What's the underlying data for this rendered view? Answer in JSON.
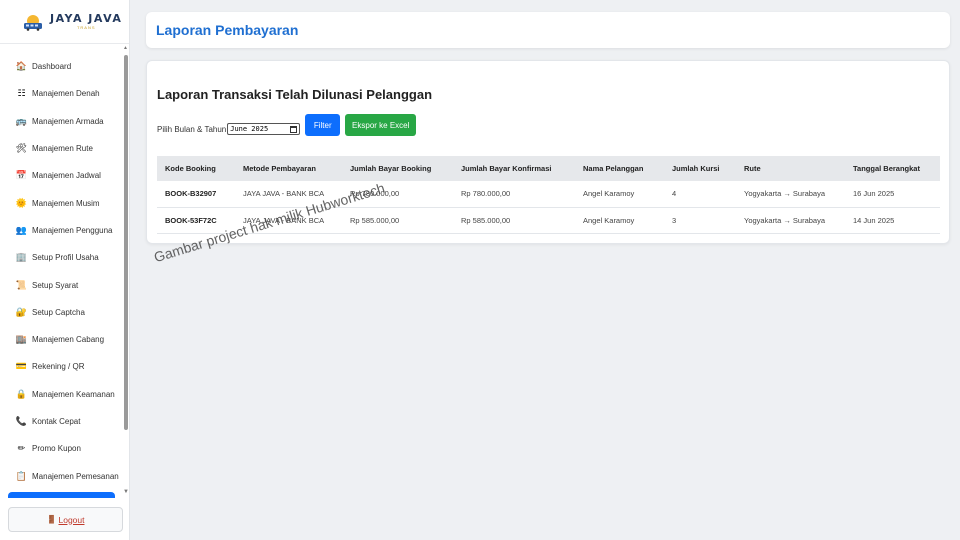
{
  "brand": {
    "name": "JAYA JAVA",
    "sub": "TRANS"
  },
  "sidebar": {
    "items": [
      {
        "label": "Dashboard",
        "icon": "🏠"
      },
      {
        "label": "Manajemen Denah",
        "icon": "☷"
      },
      {
        "label": "Manajemen Armada",
        "icon": "🚌"
      },
      {
        "label": "Manajemen Rute",
        "icon": "🛠"
      },
      {
        "label": "Manajemen Jadwal",
        "icon": "📅"
      },
      {
        "label": "Manajemen Musim",
        "icon": "🌞"
      },
      {
        "label": "Manajemen Pengguna",
        "icon": "👥"
      },
      {
        "label": "Setup Profil Usaha",
        "icon": "🏢"
      },
      {
        "label": "Setup Syarat",
        "icon": "📜"
      },
      {
        "label": "Setup Captcha",
        "icon": "🔐"
      },
      {
        "label": "Manajemen Cabang",
        "icon": "🏬"
      },
      {
        "label": "Rekening / QR",
        "icon": "💳"
      },
      {
        "label": "Manajemen Keamanan",
        "icon": "🔒"
      },
      {
        "label": "Kontak Cepat",
        "icon": "📞"
      },
      {
        "label": "Promo Kupon",
        "icon": "✏"
      },
      {
        "label": "Manajemen Pemesanan",
        "icon": "📋"
      }
    ],
    "logout": {
      "label": "Logout",
      "icon": "🚪"
    }
  },
  "header": {
    "title": "Laporan Pembayaran"
  },
  "report": {
    "title": "Laporan Transaksi Telah Dilunasi Pelanggan",
    "filter_label": "Pilih Bulan & Tahun",
    "month_value": "June 2025",
    "filter_button": "Filter",
    "export_button": "Ekspor ke Excel",
    "columns": [
      "Kode Booking",
      "Metode Pembayaran",
      "Jumlah Bayar Booking",
      "Jumlah Bayar Konfirmasi",
      "Nama Pelanggan",
      "Jumlah Kursi",
      "Rute",
      "Tanggal Berangkat"
    ],
    "rows": [
      [
        "BOOK-B32907",
        "JAYA JAVA - BANK BCA",
        "Rp 780.000,00",
        "Rp 780.000,00",
        "Angel Karamoy",
        "4",
        "Yogyakarta → Surabaya",
        "16 Jun 2025"
      ],
      [
        "BOOK-53F72C",
        "JAYA JAVA - BANK BCA",
        "Rp 585.000,00",
        "Rp 585.000,00",
        "Angel Karamoy",
        "3",
        "Yogyakarta → Surabaya",
        "14 Jun 2025"
      ]
    ]
  },
  "watermark": "Gambar project hak milik Hubworktech",
  "colors": {
    "primary": "#0d6efd",
    "success": "#28a745",
    "title_blue": "#1f6fd1",
    "danger": "#c0392b"
  }
}
